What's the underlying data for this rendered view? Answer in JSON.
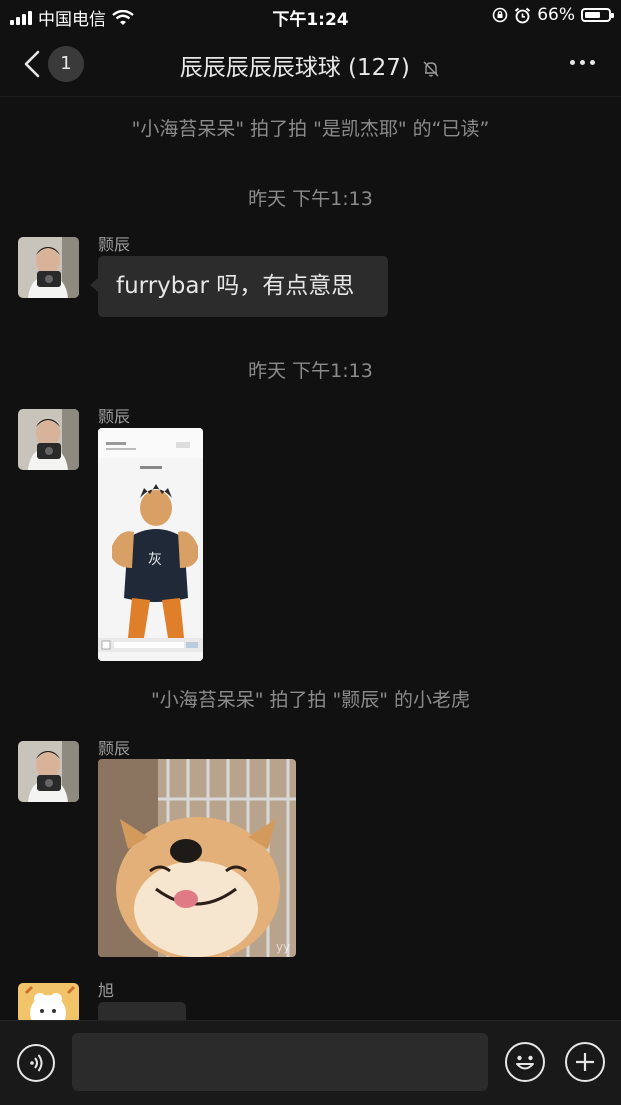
{
  "status_bar": {
    "carrier": "中国电信",
    "time": "下午1:24",
    "battery": "66%",
    "battery_level": 0.66
  },
  "nav": {
    "unread_count": "1",
    "title": "辰辰辰辰辰球球 (127)",
    "icons": [
      "back-chevron-icon",
      "mute-bell-icon",
      "more-dots-icon"
    ]
  },
  "messages": {
    "sys1": "\"小海苔呆呆\" 拍了拍 \"是凯杰耶\" 的“已读”",
    "time1": "昨天 下午1:13",
    "m1_sender": "颢辰",
    "m1_text": "furrybar 吗，有点意思",
    "time2": "昨天 下午1:13",
    "m2_sender": "颢辰",
    "sys2": "\"小海苔呆呆\" 拍了拍 \"颢辰\" 的小老虎",
    "m3_sender": "颢辰",
    "m4_sender": "旭"
  },
  "colors": {
    "background": "#111111",
    "bubble": "#2c2c2c",
    "system_text": "#8b8b8b"
  }
}
